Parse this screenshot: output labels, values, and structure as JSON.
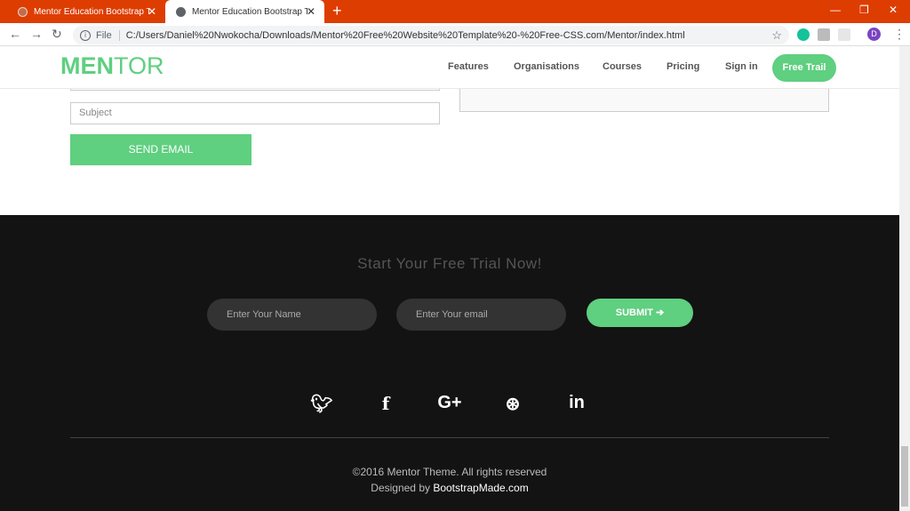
{
  "browser": {
    "tabs": [
      {
        "label": "Mentor Education Bootstrap The"
      },
      {
        "label": "Mentor Education Bootstrap The"
      }
    ],
    "new_tab": "+",
    "close": "✕",
    "file_label": "File",
    "url": "C:/Users/Daniel%20Nwokocha/Downloads/Mentor%20Free%20Website%20Template%20-%20Free-CSS.com/Mentor/index.html",
    "avatar_letter": "D"
  },
  "site": {
    "logo_main": "MEN",
    "logo_sub": "TOR",
    "nav": [
      "Features",
      "Organisations",
      "Courses",
      "Pricing",
      "Sign in"
    ],
    "free_trial": "Free Trail"
  },
  "contact": {
    "subject_placeholder": "Subject",
    "send_label": "SEND EMAIL"
  },
  "footer": {
    "cta": "Start Your Free Trial Now!",
    "name_placeholder": "Enter Your Name",
    "email_placeholder": "Enter Your email",
    "submit": "SUBMIT",
    "social": [
      "twitter-icon",
      "facebook-icon",
      "google-plus-icon",
      "dribbble-icon",
      "linkedin-icon"
    ],
    "copyright": "©2016 Mentor Theme. All rights reserved",
    "designed_prefix": "Designed by ",
    "designed_link": "BootstrapMade.com"
  },
  "colors": {
    "brand": "#5fcf80",
    "chrome_bar": "#de3d01",
    "footer_bg": "#131313"
  }
}
